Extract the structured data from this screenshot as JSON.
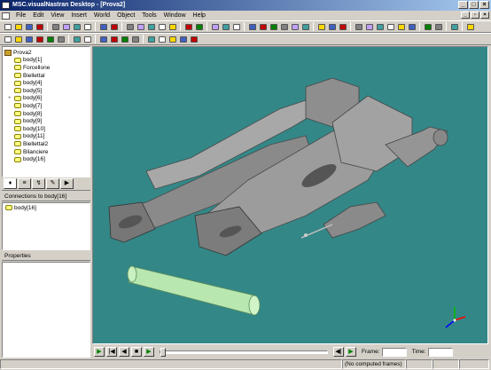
{
  "window": {
    "title": "MSC.visualNastran Desktop - [Prova2]"
  },
  "menu": [
    "File",
    "Edit",
    "View",
    "Insert",
    "World",
    "Object",
    "Tools",
    "Window",
    "Help"
  ],
  "toolbar1": [
    "new-icon",
    "open-icon",
    "save-icon",
    "print-icon",
    "sep",
    "cut-icon",
    "copy-icon",
    "paste-icon",
    "delete-icon",
    "sep",
    "undo-icon",
    "redo-icon",
    "sep",
    "move-view-icon",
    "rotate-view-icon",
    "zoom-icon",
    "zoom-fit-icon",
    "fly-icon",
    "sep",
    "camera-icon",
    "render-icon",
    "sep",
    "shade-icon",
    "wireframe-icon",
    "grid-icon",
    "sep",
    "select-arrow-icon",
    "move-icon",
    "move-axis-icon",
    "rotate-icon",
    "rotate-axis-icon",
    "scale-icon",
    "sep",
    "point-icon",
    "line-icon",
    "constraint-icon",
    "sep",
    "motor-icon",
    "spring-icon",
    "rope-icon",
    "force-icon",
    "torque-icon",
    "meter-icon",
    "sep",
    "light-icon",
    "palette-icon",
    "sep",
    "snap-icon",
    "sep",
    "options-icon"
  ],
  "toolbar2": [
    "world-icon",
    "coords-icon",
    "view-icon",
    "grid-toggle-icon",
    "plot-icon",
    "paint-icon",
    "sep",
    "color-icon",
    "motion-icon",
    "sep",
    "body-icon",
    "body-icon",
    "body-icon",
    "body-icon",
    "sep",
    "align-icon",
    "join-icon",
    "split-icon",
    "cross-icon",
    "merge-icon"
  ],
  "tree": {
    "root": "Prova2",
    "items": [
      "body[1]",
      "Forcellone",
      "Biellettal",
      "body[4]",
      "body[5]",
      "body[6]",
      "body[7]",
      "body[8]",
      "body[9]",
      "body[10]",
      "body[11]",
      "Biellettal2",
      "Bilanciere",
      "body[16]"
    ]
  },
  "tabs": [
    "tree-tab-icon",
    "properties-tab-icon",
    "coords-tab-icon",
    "appearance-tab-icon",
    "animation-tab-icon"
  ],
  "connections": {
    "header": "Connections to body[16]",
    "items": [
      "body[16]"
    ]
  },
  "properties": {
    "header": "Properties"
  },
  "animation": {
    "frame_label": "Frame:",
    "time_label": "Time:"
  },
  "status": {
    "message": "(No computed frames)"
  },
  "colors": {
    "viewport": "#348787",
    "part": "#9a9a9a",
    "rod": "#b8e8b0"
  }
}
